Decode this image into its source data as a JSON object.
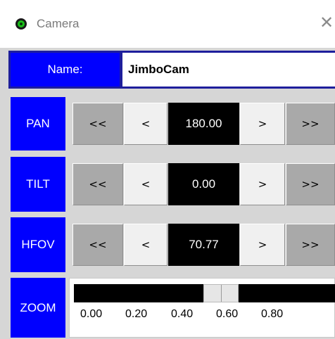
{
  "window": {
    "title": "Camera",
    "close_glyph": "✕",
    "icon": "camera-app-icon"
  },
  "name_field": {
    "label": "Name:",
    "value": "JimboCam"
  },
  "buttons": {
    "big_left": "<<",
    "left": "<",
    "right": ">",
    "big_right": ">>"
  },
  "controls": {
    "pan": {
      "label": "PAN",
      "value": "180.00"
    },
    "tilt": {
      "label": "TILT",
      "value": "0.00"
    },
    "hfov": {
      "label": "HFOV",
      "value": "70.77"
    }
  },
  "zoom": {
    "label": "ZOOM",
    "ticks": [
      "0.00",
      "0.20",
      "0.40",
      "0.60",
      "0.80"
    ],
    "level": 0.56
  },
  "colors": {
    "label_blue": "#0000ff",
    "name_border": "#1e1e9c",
    "value_bg": "#000000",
    "button_dark": "#a9a9a9",
    "button_light": "#f0f0f0",
    "panel_bg": "#d6d6d6"
  }
}
